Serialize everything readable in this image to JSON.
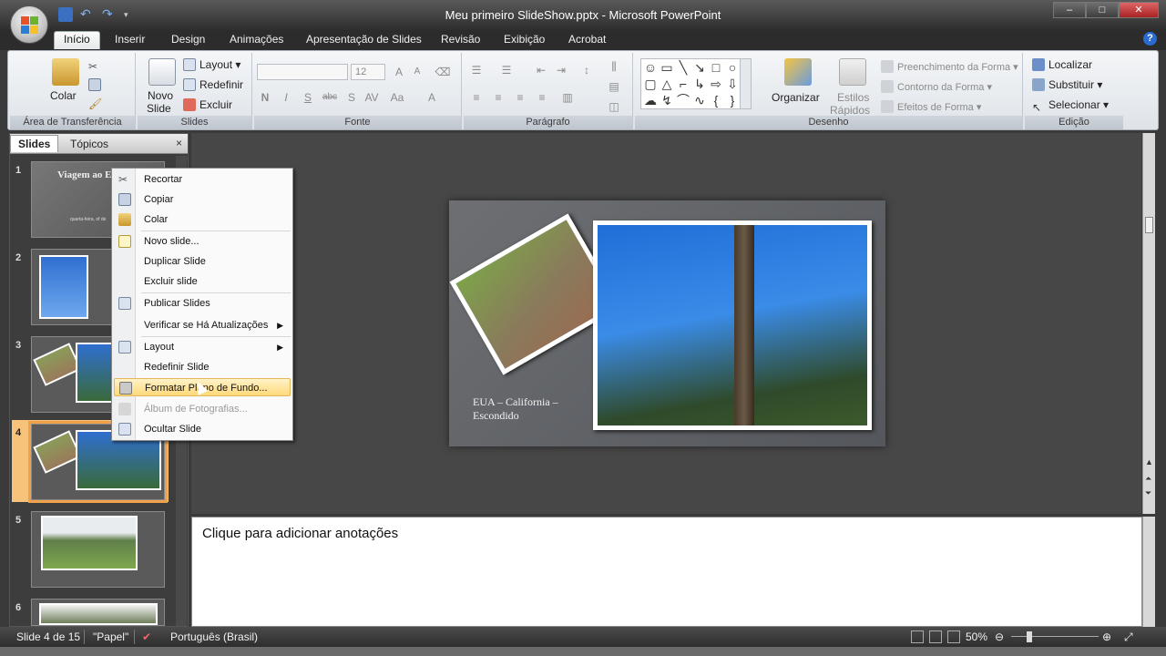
{
  "window": {
    "title": "Meu primeiro SlideShow.pptx - Microsoft PowerPoint",
    "controls": {
      "minimize": "–",
      "maximize": "□",
      "close": "✕"
    }
  },
  "quick_access": {
    "icons": [
      "save-icon",
      "undo-icon",
      "redo-icon",
      "customize-icon"
    ]
  },
  "tabs": [
    "Início",
    "Inserir",
    "Design",
    "Animações",
    "Apresentação de Slides",
    "Revisão",
    "Exibição",
    "Acrobat"
  ],
  "ribbon": {
    "clipboard": {
      "label": "Área de Transferência",
      "paste": "Colar"
    },
    "slides": {
      "label": "Slides",
      "new_slide": "Novo",
      "new_slide2": "Slide",
      "layout": "Layout",
      "reset": "Redefinir",
      "delete": "Excluir"
    },
    "font": {
      "label": "Fonte",
      "size": "12"
    },
    "paragraph": {
      "label": "Parágrafo"
    },
    "drawing": {
      "label": "Desenho",
      "organize": "Organizar",
      "quick_styles": "Estilos",
      "quick_styles2": "Rápidos",
      "shape_fill": "Preenchimento da Forma",
      "shape_outline": "Contorno da Forma",
      "shape_effects": "Efeitos de Forma"
    },
    "editing": {
      "label": "Edição",
      "find": "Localizar",
      "replace": "Substituir",
      "select": "Selecionar"
    }
  },
  "slides_pane": {
    "tab_slides": "Slides",
    "tab_outline": "Tópicos",
    "close": "×",
    "numbers": [
      "1",
      "2",
      "3",
      "4",
      "5",
      "6"
    ],
    "thumb1_title": "Viagem ao E",
    "thumb1_sub": "quarta-feira, of de"
  },
  "context_menu": {
    "items": [
      {
        "label": "Recortar",
        "icon": "cut-icon",
        "enabled": true
      },
      {
        "label": "Copiar",
        "icon": "copy-icon",
        "enabled": true
      },
      {
        "label": "Colar",
        "icon": "paste-icon",
        "enabled": true
      },
      {
        "label": "Novo slide...",
        "icon": "new-slide-icon",
        "enabled": true
      },
      {
        "label": "Duplicar Slide",
        "icon": "",
        "enabled": true
      },
      {
        "label": "Excluir slide",
        "icon": "",
        "enabled": true
      },
      {
        "label": "Publicar Slides",
        "icon": "publish-icon",
        "enabled": true
      },
      {
        "label": "Verificar se Há Atualizações",
        "icon": "",
        "enabled": true
      },
      {
        "label": "Layout",
        "icon": "layout-icon",
        "enabled": true
      },
      {
        "label": "Redefinir Slide",
        "icon": "",
        "enabled": true
      },
      {
        "label": "Formatar Plano de Fundo...",
        "icon": "format-background-icon",
        "enabled": true
      },
      {
        "label": "Álbum de Fotografias...",
        "icon": "photo-album-icon",
        "enabled": false
      },
      {
        "label": "Ocultar Slide",
        "icon": "hide-slide-icon",
        "enabled": true
      }
    ]
  },
  "slide": {
    "caption_line1": "EUA – California –",
    "caption_line2": "Escondido"
  },
  "notes": {
    "placeholder": "Clique para adicionar anotações"
  },
  "status": {
    "slide_info": "Slide 4 de 15",
    "theme": "\"Papel\"",
    "language": "Português (Brasil)",
    "zoom": "50%"
  }
}
